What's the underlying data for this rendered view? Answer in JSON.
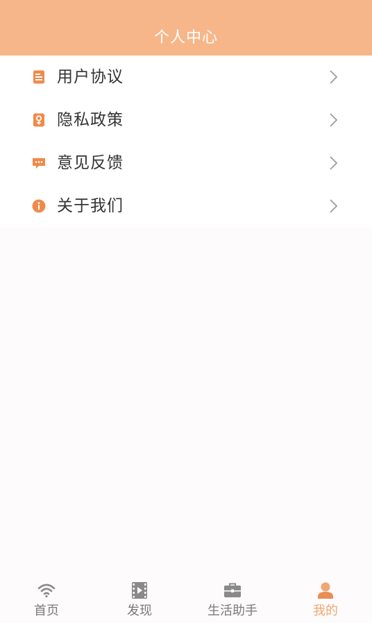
{
  "header": {
    "title": "个人中心"
  },
  "menu": {
    "items": [
      {
        "label": "用户协议",
        "icon": "document-icon"
      },
      {
        "label": "隐私政策",
        "icon": "privacy-icon"
      },
      {
        "label": "意见反馈",
        "icon": "message-icon"
      },
      {
        "label": "关于我们",
        "icon": "info-icon"
      }
    ]
  },
  "tabbar": {
    "tabs": [
      {
        "label": "首页",
        "icon": "wifi-icon",
        "active": false
      },
      {
        "label": "发现",
        "icon": "film-icon",
        "active": false
      },
      {
        "label": "生活助手",
        "icon": "briefcase-icon",
        "active": false
      },
      {
        "label": "我的",
        "icon": "user-icon",
        "active": true
      }
    ]
  },
  "colors": {
    "header_bg": "#f7b68a",
    "icon_orange": "#f08a4b",
    "active_tab": "#f0a771",
    "inactive_tab": "#7a7a7a"
  }
}
